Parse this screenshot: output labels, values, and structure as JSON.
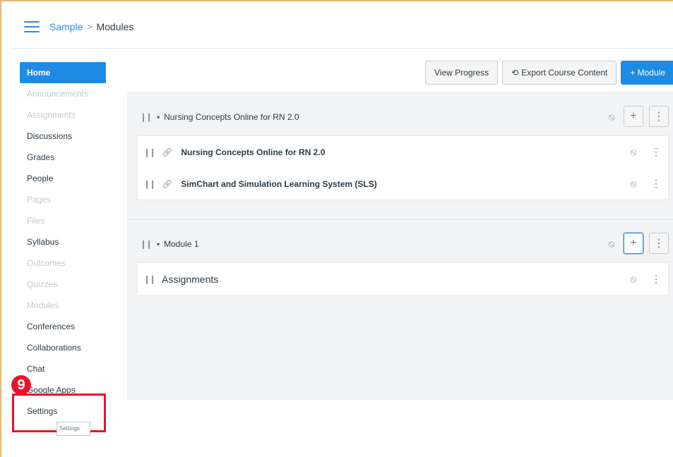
{
  "header": {
    "breadcrumb": {
      "course": "Sample",
      "separator": ">",
      "current": "Modules"
    }
  },
  "sidebar": {
    "items": [
      {
        "label": "Home",
        "state": "active"
      },
      {
        "label": "Announcements",
        "state": "faded"
      },
      {
        "label": "Assignments",
        "state": "faded"
      },
      {
        "label": "Discussions",
        "state": "normal"
      },
      {
        "label": "Grades",
        "state": "normal"
      },
      {
        "label": "People",
        "state": "normal"
      },
      {
        "label": "Pages",
        "state": "faded"
      },
      {
        "label": "Files",
        "state": "faded"
      },
      {
        "label": "Syllabus",
        "state": "normal"
      },
      {
        "label": "Outcomes",
        "state": "faded"
      },
      {
        "label": "Quizzes",
        "state": "faded"
      },
      {
        "label": "Modules",
        "state": "faded"
      },
      {
        "label": "Conferences",
        "state": "normal"
      },
      {
        "label": "Collaborations",
        "state": "normal"
      },
      {
        "label": "Chat",
        "state": "normal"
      },
      {
        "label": "Google Apps",
        "state": "normal"
      },
      {
        "label": "Settings",
        "state": "normal"
      }
    ],
    "tooltip": "Settings"
  },
  "annotation": {
    "step": "9"
  },
  "toolbar": {
    "view_progress": "View Progress",
    "export": "Export Course Content",
    "add_module": "+ Module"
  },
  "modules": [
    {
      "title": "Nursing Concepts Online for RN 2.0",
      "items": [
        {
          "title": "Nursing Concepts Online for RN 2.0",
          "type": "link"
        },
        {
          "title": "SimChart and Simulation Learning System (SLS)",
          "type": "link"
        }
      ]
    },
    {
      "title": "Module 1",
      "items": [
        {
          "title": "Assignments",
          "type": "header"
        }
      ]
    }
  ],
  "colors": {
    "accent": "#1f8ae3",
    "annotation": "#e8132a"
  }
}
